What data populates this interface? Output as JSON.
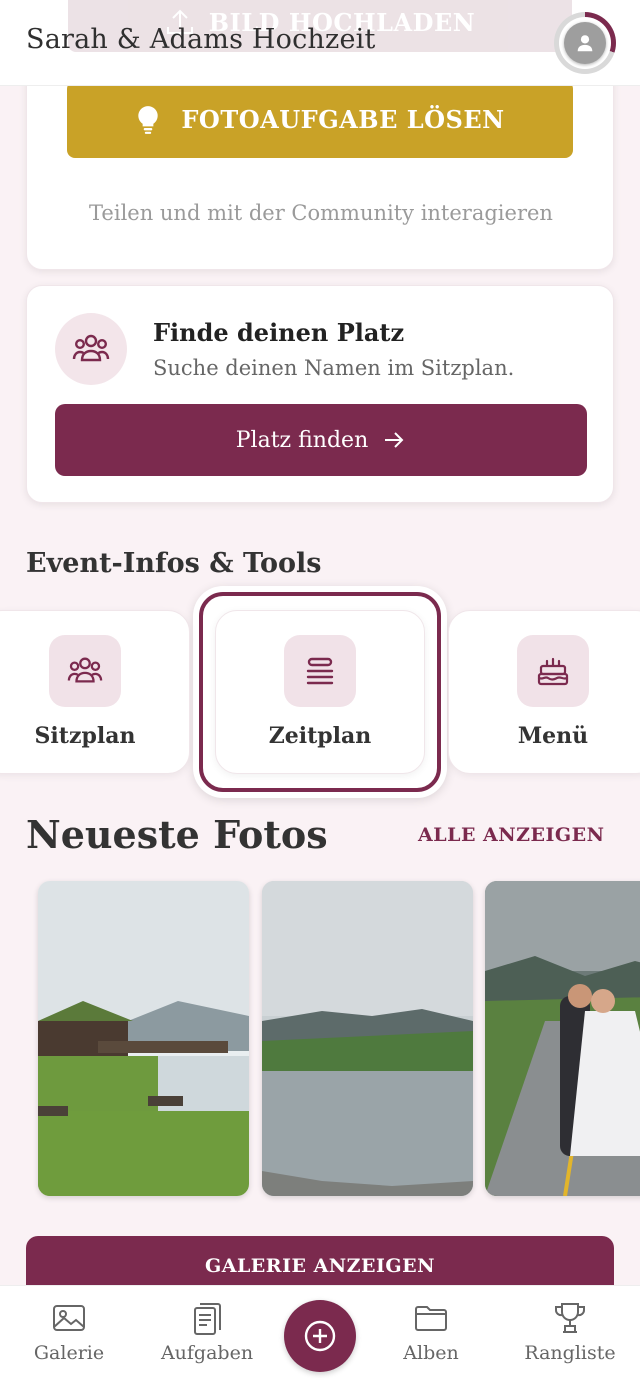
{
  "header": {
    "title": "Sarah & Adams Hochzeit",
    "upload_label": "BILD HOCHLADEN"
  },
  "task_card": {
    "button_label": "FOTOAUFGABE LÖSEN",
    "subtitle": "Teilen und mit der Community interagieren"
  },
  "seat_card": {
    "title": "Finde deinen Platz",
    "subtitle": "Suche deinen Namen im Sitzplan.",
    "button_label": "Platz finden"
  },
  "tools": {
    "section_title": "Event-Infos & Tools",
    "items": [
      {
        "label": "Sitzplan",
        "icon": "users-icon"
      },
      {
        "label": "Zeitplan",
        "icon": "list-icon"
      },
      {
        "label": "Menü",
        "icon": "cake-icon"
      }
    ]
  },
  "photos": {
    "title": "Neueste Fotos",
    "show_all": "ALLE ANZEIGEN",
    "gallery_button": "GALERIE ANZEIGEN"
  },
  "nav": {
    "items": [
      {
        "label": "Galerie",
        "icon": "image-icon"
      },
      {
        "label": "Aufgaben",
        "icon": "clipboard-icon"
      },
      {
        "label": "Alben",
        "icon": "folder-icon"
      },
      {
        "label": "Rangliste",
        "icon": "trophy-icon"
      }
    ]
  },
  "colors": {
    "primary": "#7b2a4e",
    "gold": "#c9a227",
    "background": "#faf2f5"
  }
}
